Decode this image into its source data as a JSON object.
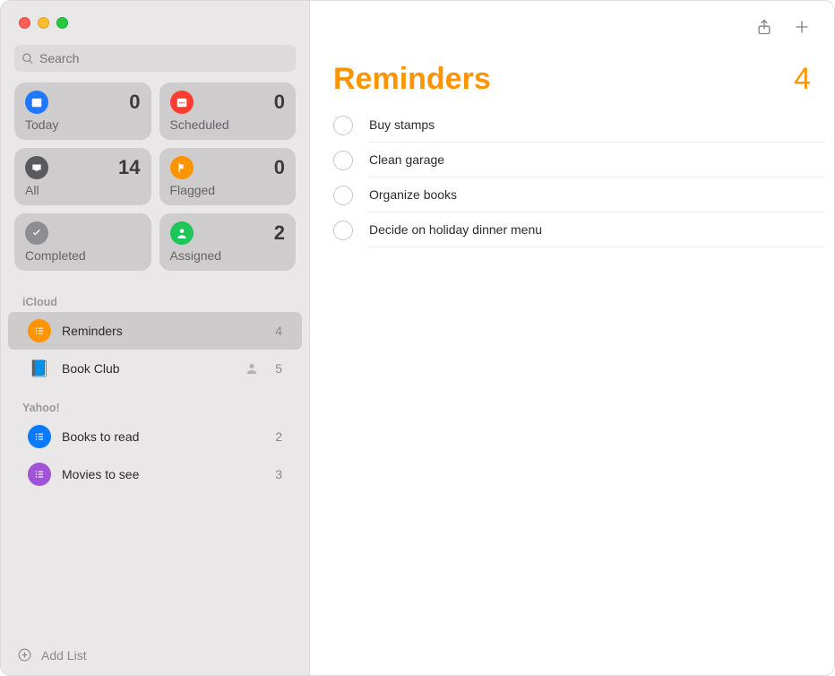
{
  "search": {
    "placeholder": "Search"
  },
  "smart": {
    "today": {
      "label": "Today",
      "count": 0,
      "color": "#1f78ff"
    },
    "scheduled": {
      "label": "Scheduled",
      "count": 0,
      "color": "#fe3c30"
    },
    "all": {
      "label": "All",
      "count": 14,
      "color": "#5a5a5e"
    },
    "flagged": {
      "label": "Flagged",
      "count": 0,
      "color": "#fe9500"
    },
    "completed": {
      "label": "Completed",
      "count": "",
      "color": "#8e8d92"
    },
    "assigned": {
      "label": "Assigned",
      "count": 2,
      "color": "#1cc657"
    }
  },
  "sections": [
    {
      "title": "iCloud",
      "lists": [
        {
          "name": "Reminders",
          "count": 4,
          "color": "#fe9500",
          "selected": true,
          "shared": false,
          "icon": "list"
        },
        {
          "name": "Book Club",
          "count": 5,
          "color": "#2a6fc8",
          "selected": false,
          "shared": true,
          "icon": "book"
        }
      ]
    },
    {
      "title": "Yahoo!",
      "lists": [
        {
          "name": "Books to read",
          "count": 2,
          "color": "#0a7bff",
          "selected": false,
          "shared": false,
          "icon": "list"
        },
        {
          "name": "Movies to see",
          "count": 3,
          "color": "#a053d7",
          "selected": false,
          "shared": false,
          "icon": "list"
        }
      ]
    }
  ],
  "footer": {
    "add_list": "Add List"
  },
  "main": {
    "title": "Reminders",
    "count": 4,
    "items": [
      {
        "title": "Buy stamps"
      },
      {
        "title": "Clean garage"
      },
      {
        "title": "Organize books"
      },
      {
        "title": "Decide on holiday dinner menu"
      }
    ]
  }
}
